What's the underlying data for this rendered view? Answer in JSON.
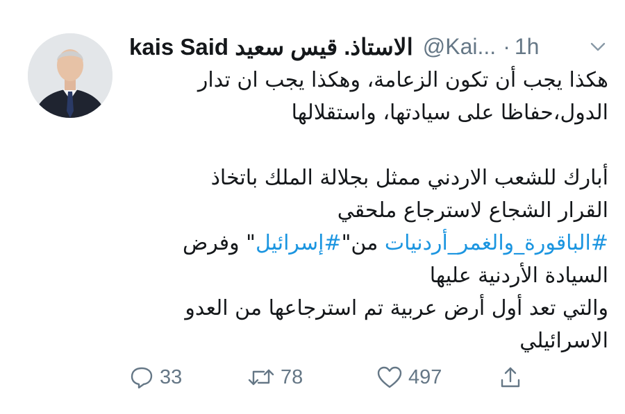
{
  "tweet": {
    "author": {
      "name": "kais Said الاستاذ. قيس سعيد",
      "handle": "@Kai...",
      "separator": "·",
      "time": "1h"
    },
    "body_lines": [
      "هكذا يجب أن تكون الزعامة، وهكذا يجب ان تدار",
      "الدول،حفاظا على سيادتها، واستقلالها",
      "",
      "أبارك للشعب الاردني ممثل بجلالة الملك باتخاذ",
      "القرار الشجاع لاسترجاع ملحقي"
    ],
    "hashtag_line": {
      "hashtag1": "#الباقورة_والغمر_أردنيات",
      "text1": " من\"",
      "hashtag2": "#إسرائيل",
      "text2": "\" وفرض"
    },
    "body_lines_2": [
      "السيادة الأردنية عليها",
      "والتي تعد أول أرض عربية تم استرجاعها من العدو",
      "الاسرائيلي"
    ],
    "actions": {
      "replies": "33",
      "retweets": "78",
      "likes": "497"
    }
  },
  "icons": {
    "caret": "chevron-down-icon",
    "reply": "reply-icon",
    "retweet": "retweet-icon",
    "like": "heart-icon",
    "share": "share-icon"
  },
  "colors": {
    "text": "#14171a",
    "secondary": "#657786",
    "link": "#1b95e0"
  }
}
